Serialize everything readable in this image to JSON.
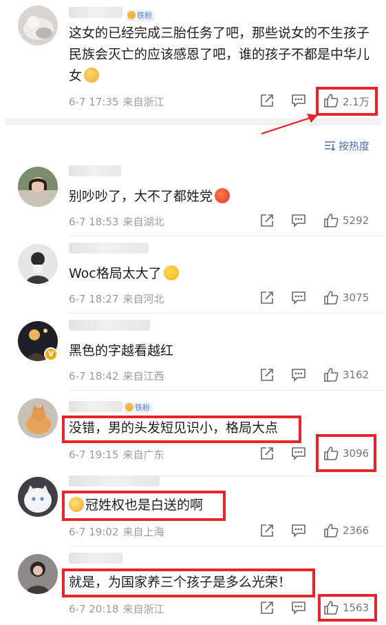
{
  "sort_label": "按热度",
  "top_comment": {
    "text": "这女的已经完成三胎任务了吧，那些说女的不生孩子民族会灭亡的应该感恩了吧，谁的孩子不都是中华儿女",
    "badge": "铁粉",
    "time": "6-7 17:35",
    "location": "来自浙江",
    "likes": "2.1万"
  },
  "comments": [
    {
      "text": "别吵吵了，大不了都姓党",
      "time": "6-7 18:53",
      "location": "来自湖北",
      "likes": "5292"
    },
    {
      "text": "Woc格局太大了",
      "time": "6-7 18:27",
      "location": "来自河北",
      "likes": "3075"
    },
    {
      "text": "黑色的字越看越红",
      "time": "6-7 18:42",
      "location": "来自江西",
      "likes": "3162"
    },
    {
      "text": "没错，男的头发短见识小，格局大点",
      "badge": "铁粉",
      "time": "6-7 19:15",
      "location": "来自广东",
      "likes": "3096"
    },
    {
      "text": "冠姓权也是白送的啊",
      "time": "6-7 19:02",
      "location": "来自上海",
      "likes": "2366"
    },
    {
      "text": "就是，为国家养三个孩子是多么光荣！",
      "time": "6-7 20:18",
      "location": "来自浙江",
      "likes": "1563"
    }
  ],
  "colors": {
    "highlight": "#e8232a",
    "sort_link": "#4a6fb5",
    "meta": "#9a9a9a"
  },
  "icons": [
    "share-icon",
    "comment-icon",
    "like-icon",
    "sort-icon",
    "annotation-arrow"
  ]
}
